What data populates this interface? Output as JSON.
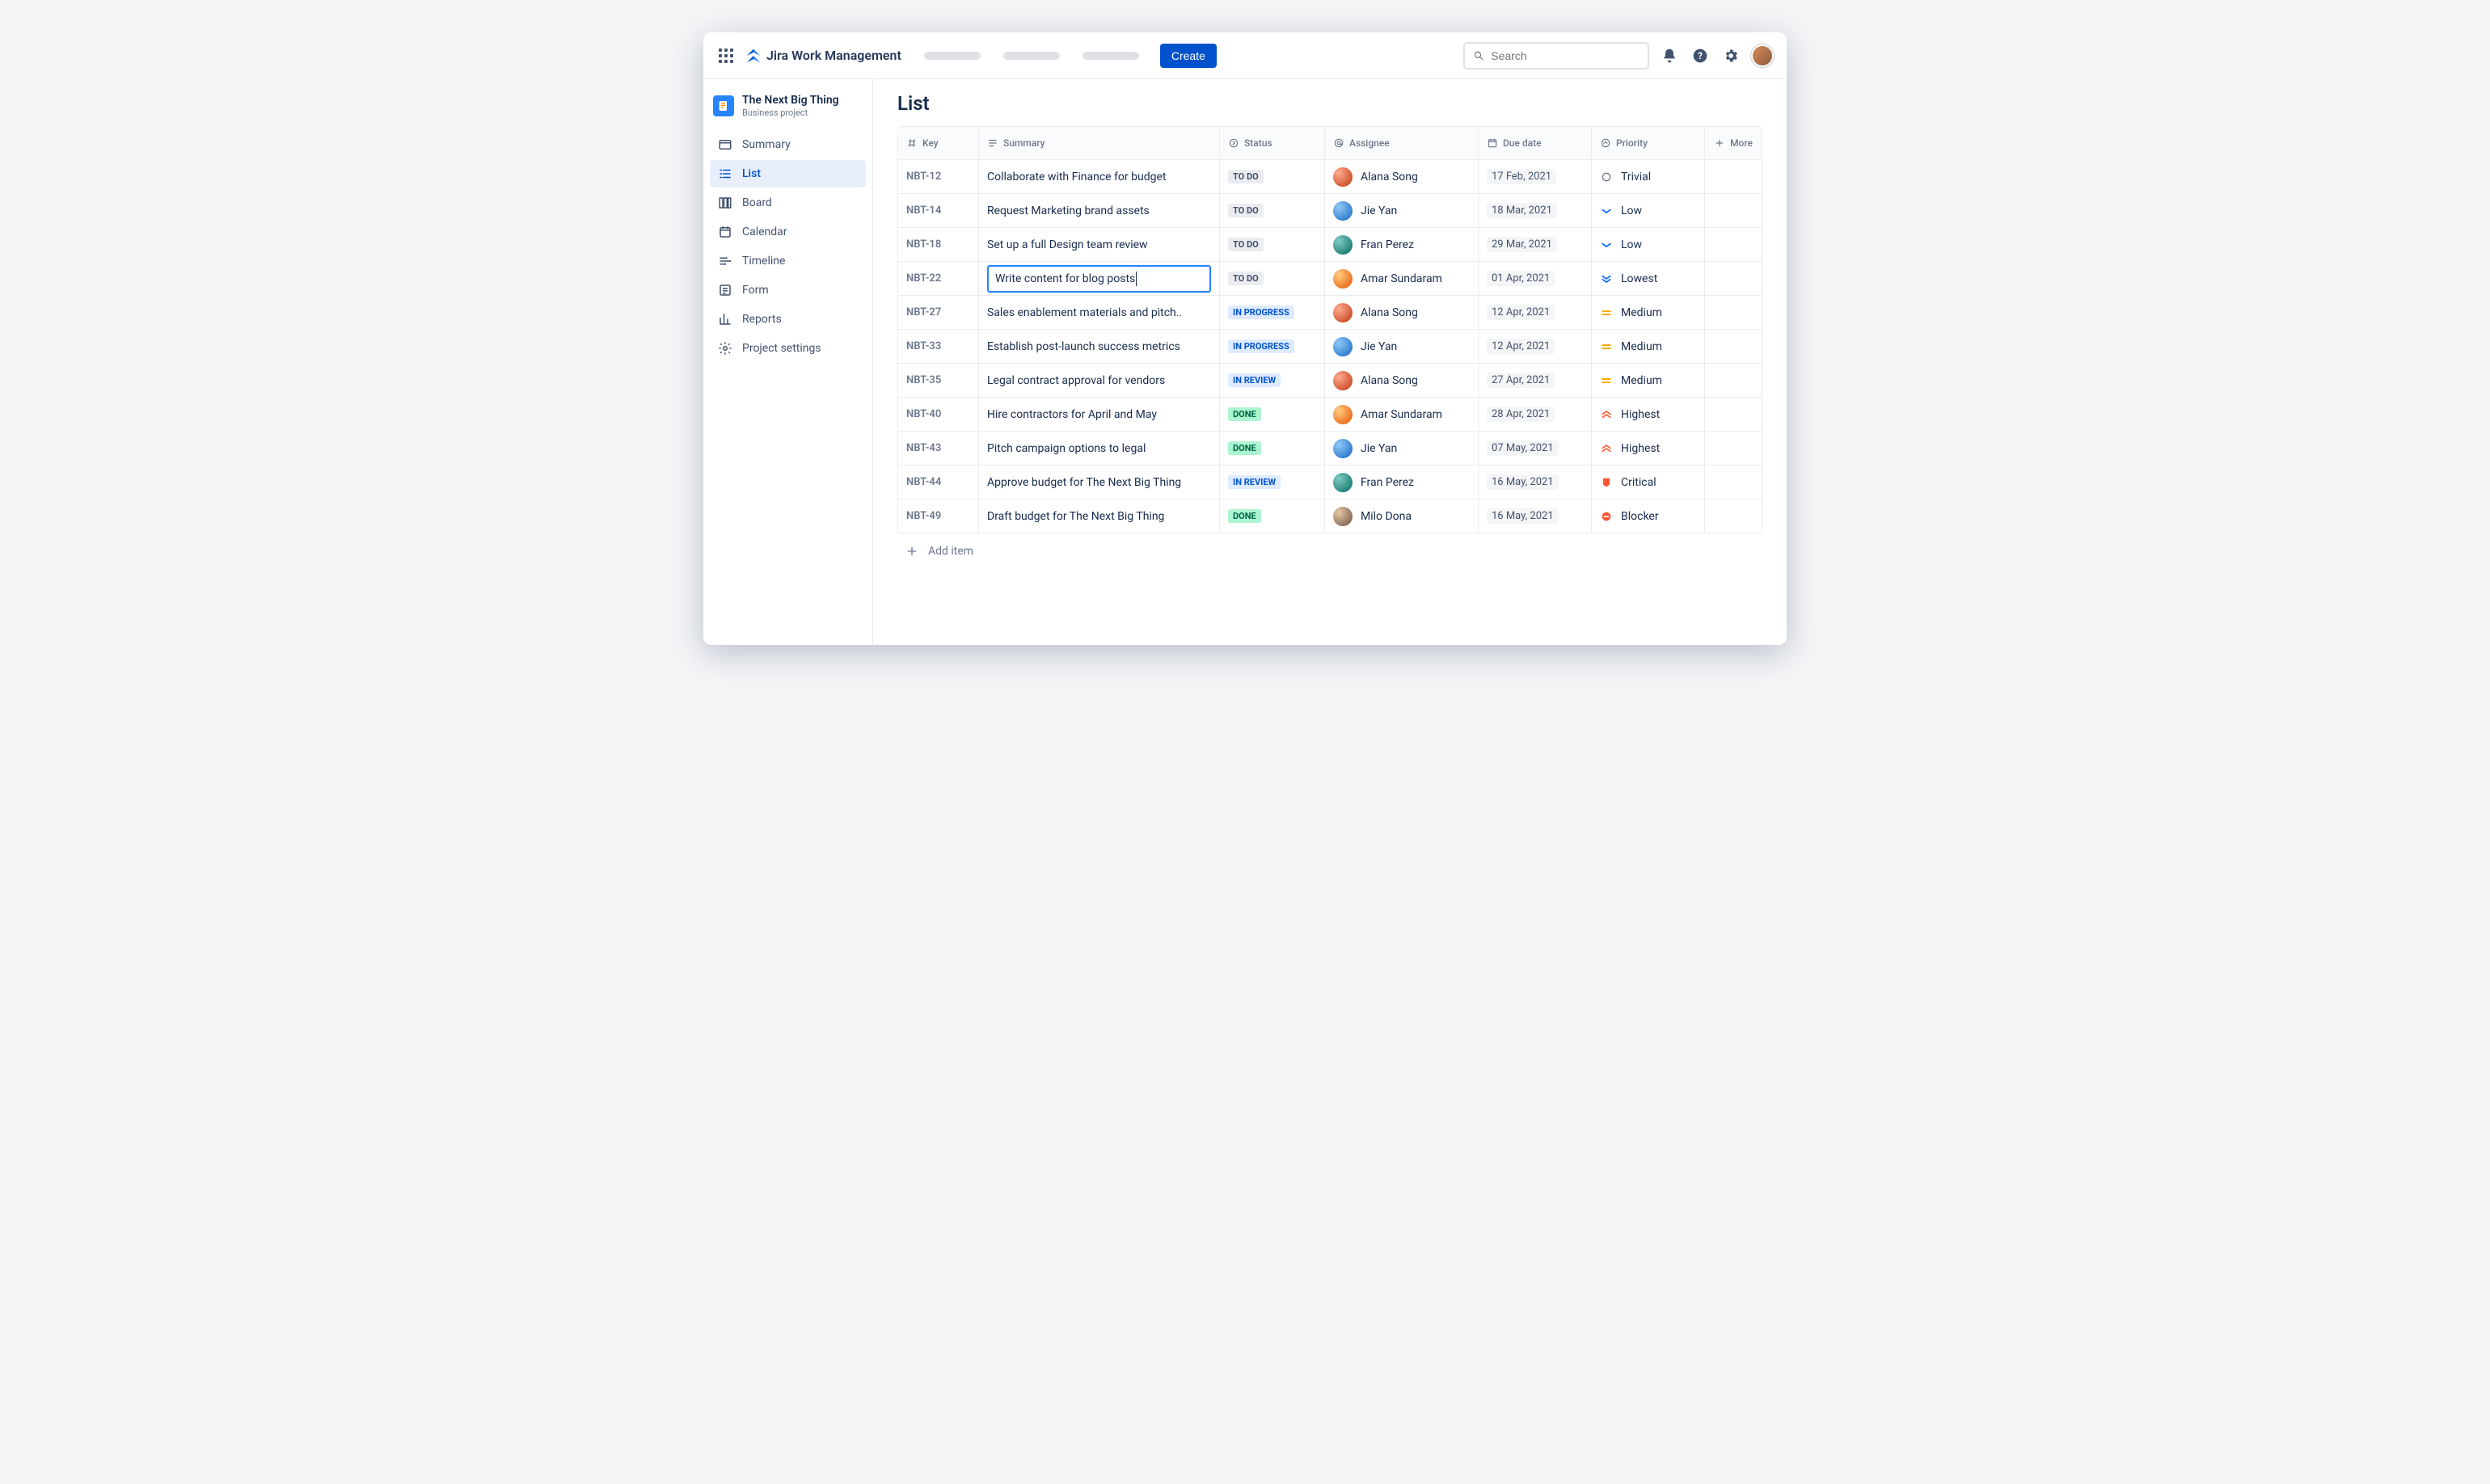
{
  "header": {
    "product_name": "Jira Work Management",
    "create_label": "Create",
    "search_placeholder": "Search"
  },
  "project": {
    "name": "The Next Big Thing",
    "type": "Business project"
  },
  "sidebar": {
    "items": [
      {
        "label": "Summary",
        "icon": "summary"
      },
      {
        "label": "List",
        "icon": "list",
        "active": true
      },
      {
        "label": "Board",
        "icon": "board"
      },
      {
        "label": "Calendar",
        "icon": "calendar"
      },
      {
        "label": "Timeline",
        "icon": "timeline"
      },
      {
        "label": "Form",
        "icon": "form"
      },
      {
        "label": "Reports",
        "icon": "reports"
      },
      {
        "label": "Project settings",
        "icon": "settings"
      }
    ]
  },
  "page": {
    "title": "List",
    "columns": {
      "key": "Key",
      "summary": "Summary",
      "status": "Status",
      "assignee": "Assignee",
      "due": "Due date",
      "priority": "Priority",
      "more": "More"
    },
    "add_item_label": "Add item"
  },
  "statuses": {
    "todo": "TO DO",
    "inprogress": "IN PROGRESS",
    "inreview": "IN REVIEW",
    "done": "DONE"
  },
  "priorities": {
    "trivial": "Trivial",
    "low": "Low",
    "lowest": "Lowest",
    "medium": "Medium",
    "highest": "Highest",
    "critical": "Critical",
    "blocker": "Blocker"
  },
  "assignees": {
    "alana": "Alana Song",
    "jie": "Jie Yan",
    "fran": "Fran Perez",
    "amar": "Amar Sundaram",
    "milo": "Milo Dona"
  },
  "rows": [
    {
      "key": "NBT-12",
      "summary": "Collaborate with Finance for budget",
      "status": "todo",
      "assignee": "alana",
      "av": "red",
      "due": "17 Feb, 2021",
      "priority": "trivial"
    },
    {
      "key": "NBT-14",
      "summary": "Request Marketing brand assets",
      "status": "todo",
      "assignee": "jie",
      "av": "blue",
      "due": "18 Mar, 2021",
      "priority": "low"
    },
    {
      "key": "NBT-18",
      "summary": "Set up a full Design team review",
      "status": "todo",
      "assignee": "fran",
      "av": "teal",
      "due": "29 Mar, 2021",
      "priority": "low"
    },
    {
      "key": "NBT-22",
      "summary": "Write content for blog posts",
      "status": "todo",
      "assignee": "amar",
      "av": "orange",
      "due": "01 Apr, 2021",
      "priority": "lowest",
      "editing": true
    },
    {
      "key": "NBT-27",
      "summary": "Sales enablement materials and pitch..",
      "status": "inprogress",
      "assignee": "alana",
      "av": "red",
      "due": "12 Apr, 2021",
      "priority": "medium"
    },
    {
      "key": "NBT-33",
      "summary": "Establish post-launch success metrics",
      "status": "inprogress",
      "assignee": "jie",
      "av": "blue",
      "due": "12 Apr, 2021",
      "priority": "medium"
    },
    {
      "key": "NBT-35",
      "summary": "Legal contract approval for vendors",
      "status": "inreview",
      "assignee": "alana",
      "av": "red",
      "due": "27 Apr, 2021",
      "priority": "medium"
    },
    {
      "key": "NBT-40",
      "summary": "Hire contractors for April and May",
      "status": "done",
      "assignee": "amar",
      "av": "orange",
      "due": "28 Apr, 2021",
      "priority": "highest"
    },
    {
      "key": "NBT-43",
      "summary": "Pitch campaign options to legal",
      "status": "done",
      "assignee": "jie",
      "av": "blue",
      "due": "07 May, 2021",
      "priority": "highest"
    },
    {
      "key": "NBT-44",
      "summary": "Approve budget for The Next Big Thing",
      "status": "inreview",
      "assignee": "fran",
      "av": "teal",
      "due": "16 May, 2021",
      "priority": "critical"
    },
    {
      "key": "NBT-49",
      "summary": "Draft budget for The Next Big Thing",
      "status": "done",
      "assignee": "milo",
      "av": "tan",
      "due": "16 May, 2021",
      "priority": "blocker"
    }
  ]
}
